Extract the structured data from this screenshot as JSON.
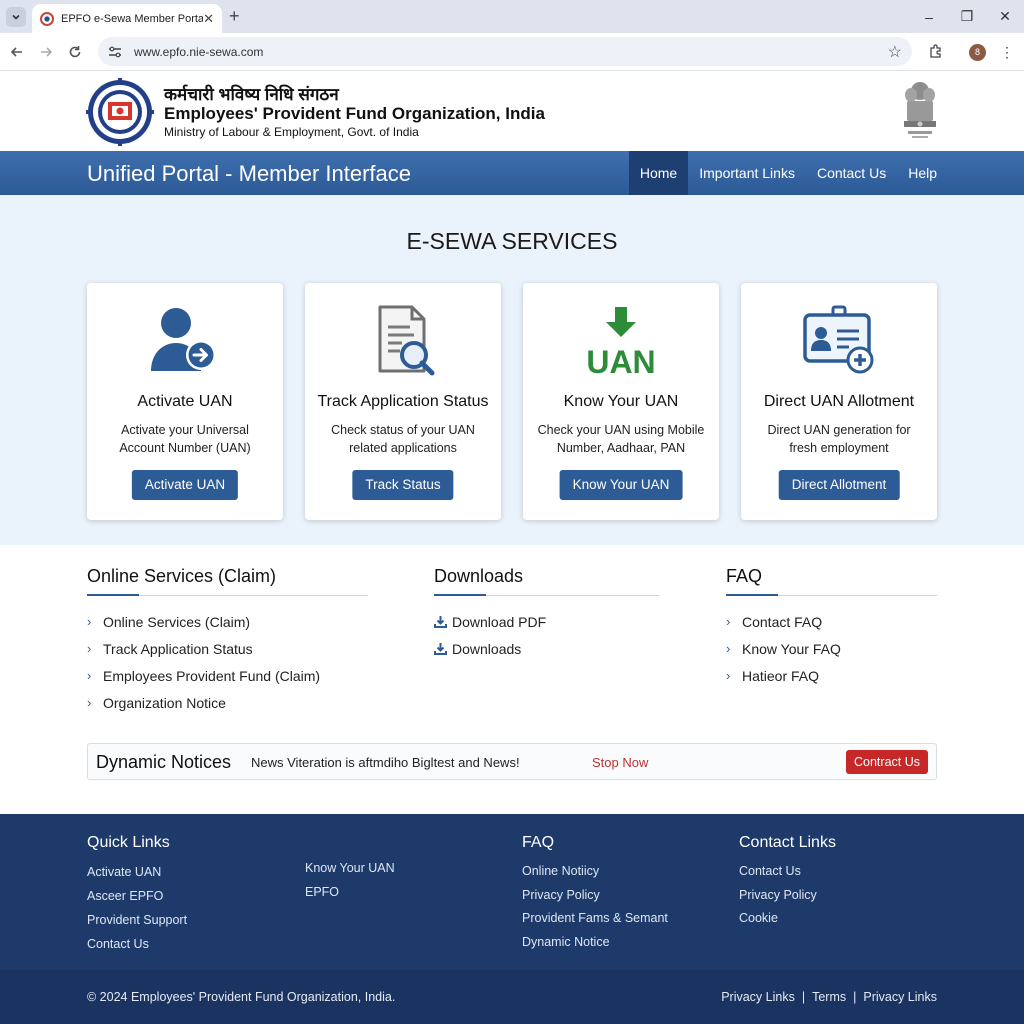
{
  "browser": {
    "tab_title": "EPFO e-Sewa Member Portal",
    "tab_close": "✕",
    "new_tab": "+",
    "url": "www.epfo.nie-sewa.com",
    "profile_initial": "8",
    "window_controls": [
      "–",
      "❐",
      "✕"
    ]
  },
  "header": {
    "hindi_name": "कर्मचारी भविष्य निधि संगठन",
    "english_name": "Employees' Provident Fund Organization, India",
    "ministry": "Ministry of Labour & Employment, Govt. of India"
  },
  "navbar": {
    "portal_title": "Unified Portal - Member Interface",
    "items": [
      {
        "label": "Home",
        "active": true
      },
      {
        "label": "Important Links"
      },
      {
        "label": "Contact Us"
      },
      {
        "label": "Help"
      }
    ]
  },
  "services": {
    "title": "E-SEWA SERVICES",
    "cards": [
      {
        "icon": "user-arrow-icon",
        "title": "Activate UAN",
        "desc": "Activate your Universal Account Number (UAN)",
        "button": "Activate UAN"
      },
      {
        "icon": "document-search-icon",
        "title": "Track Application Status",
        "desc": "Check status of your UAN related applications",
        "button": "Track Status"
      },
      {
        "icon": "uan-download-icon",
        "title": "Know Your UAN",
        "desc": "Check your UAN using Mobile Number, Aadhaar, PAN",
        "button": "Know Your UAN",
        "icon_text": "UAN"
      },
      {
        "icon": "id-card-plus-icon",
        "title": "Direct UAN Allotment",
        "desc": "Direct UAN generation for fresh employment",
        "button": "Direct Allotment"
      }
    ]
  },
  "columns": {
    "online": {
      "title": "Online Services (Claim)",
      "items": [
        "Online Services (Claim)",
        "Track Application Status",
        "Employees Provident Fund (Claim)",
        "Organization Notice"
      ]
    },
    "downloads": {
      "title": "Downloads",
      "items": [
        "Download PDF",
        "Downloads"
      ]
    },
    "faq": {
      "title": "FAQ",
      "items": [
        "Contact FAQ",
        "Know Your FAQ",
        "Hatieor FAQ"
      ]
    }
  },
  "notices": {
    "title": "Dynamic Notices",
    "ticker": "News Viteration is aftmdiho Bigltest and News!",
    "stop": "Stop Now",
    "button": "Contract Us"
  },
  "footer": {
    "quick_links": {
      "title": "Quick Links",
      "col1": [
        "Activate UAN",
        "Asceer EPFO",
        "Provident Support",
        "Contact Us"
      ],
      "col2": [
        "Know Your UAN",
        "EPFO"
      ]
    },
    "faq": {
      "title": "FAQ",
      "items": [
        "Online Notiicy",
        "Privacy Policy",
        "Provident Fams & Semant",
        "Dynamic Notice"
      ]
    },
    "contact": {
      "title": "Contact Links",
      "items": [
        "Contact Us",
        "Privacy Policy",
        "Cookie"
      ]
    },
    "copyright": "© 2024 Employees' Provident Fund Organization, India.",
    "bottom_links": [
      "Privacy Links",
      "Terms",
      "Privacy Links"
    ],
    "separator": "|"
  },
  "colors": {
    "primary": "#2d5b95",
    "nav": "#3f6fae",
    "footer": "#1e3a6a",
    "danger": "#c62828",
    "icon_green": "#2e8b3a",
    "section_bg": "#eaf2fb"
  }
}
